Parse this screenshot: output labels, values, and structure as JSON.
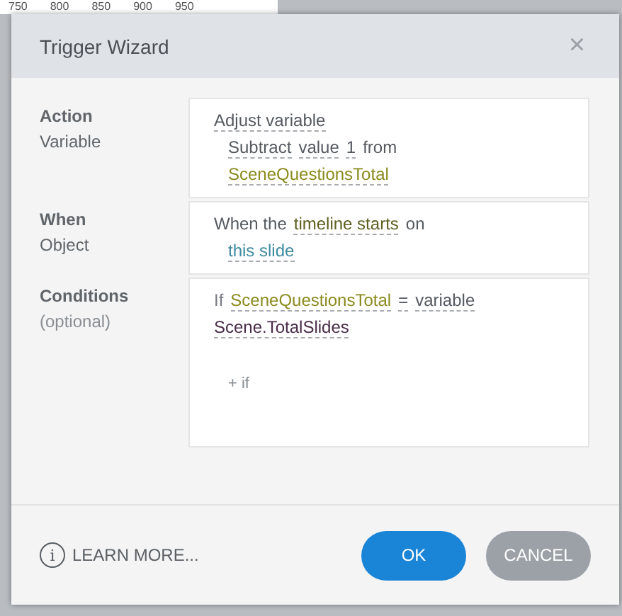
{
  "ruler": [
    "750",
    "800",
    "850",
    "900",
    "950"
  ],
  "dialog": {
    "title": "Trigger Wizard",
    "close": "×"
  },
  "sections": [
    {
      "rows": [
        {
          "label": "Action",
          "kind": "heading",
          "parts": [
            {
              "text": "Adjust variable",
              "kind": "link",
              "color": "#555a60"
            }
          ]
        },
        {
          "label": "Variable",
          "kind": "field",
          "parts": [
            {
              "text": "Subtract",
              "kind": "link",
              "color": "#555a60"
            },
            {
              "text": "value",
              "kind": "link",
              "color": "#555a60"
            },
            {
              "text": "1",
              "kind": "link",
              "color": "#555a60"
            },
            {
              "text": "from",
              "kind": "plain",
              "color": "#555a60"
            },
            {
              "text": "SceneQuestionsTotal",
              "kind": "link",
              "color": "#8a8a1e"
            }
          ]
        }
      ]
    },
    {
      "rows": [
        {
          "label": "When",
          "kind": "heading",
          "parts": [
            {
              "text": "When the",
              "kind": "plain",
              "color": "#555a60"
            },
            {
              "text": "timeline starts",
              "kind": "link",
              "color": "#5f6020"
            },
            {
              "text": "on",
              "kind": "plain",
              "color": "#555a60"
            }
          ]
        },
        {
          "label": "Object",
          "kind": "field",
          "parts": [
            {
              "text": "this slide",
              "kind": "link",
              "color": "#3d8aa0"
            }
          ]
        }
      ]
    },
    {
      "rows": [
        {
          "label": "Conditions",
          "note": "(optional)",
          "kind": "heading",
          "parts": [
            {
              "text": "If",
              "kind": "plain",
              "color": "#777b80"
            },
            {
              "text": "SceneQuestionsTotal",
              "kind": "link",
              "color": "#8a8a1e"
            },
            {
              "text": "=",
              "kind": "link",
              "color": "#555a60"
            },
            {
              "text": "variable",
              "kind": "link",
              "color": "#555a60"
            },
            {
              "text": "Scene.TotalSlides",
              "kind": "link",
              "color": "#4a2c48"
            }
          ]
        }
      ],
      "add": "+ if"
    }
  ],
  "footer": {
    "learn_more": "LEARN MORE...",
    "info_icon": "i",
    "buttons": [
      {
        "label": "OK",
        "kind": "primary"
      },
      {
        "label": "CANCEL",
        "kind": "secondary"
      }
    ]
  }
}
